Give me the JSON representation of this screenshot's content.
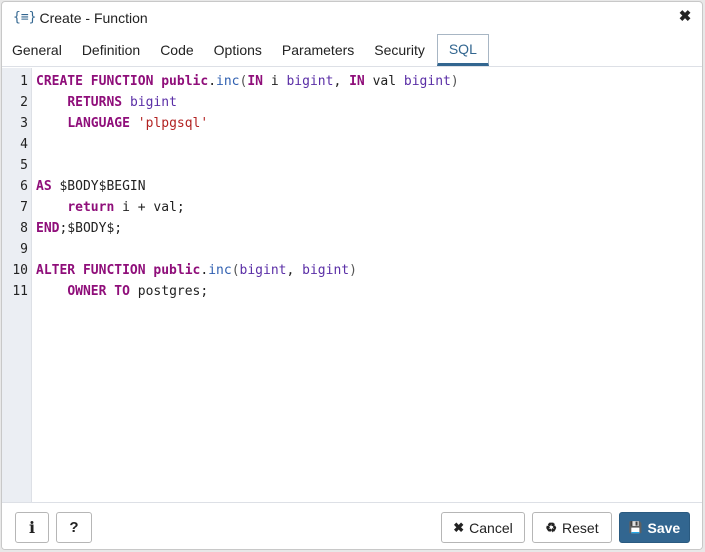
{
  "dialog": {
    "icon": "{≡}",
    "title": "Create - Function",
    "close_glyph": "✖"
  },
  "tabs": [
    {
      "label": "General"
    },
    {
      "label": "Definition"
    },
    {
      "label": "Code"
    },
    {
      "label": "Options"
    },
    {
      "label": "Parameters"
    },
    {
      "label": "Security"
    },
    {
      "label": "SQL",
      "active": true
    }
  ],
  "editor": {
    "line_numbers": [
      "1",
      "2",
      "3",
      "4",
      "5",
      "6",
      "7",
      "8",
      "9",
      "10",
      "11"
    ],
    "lines": [
      [
        {
          "t": "CREATE FUNCTION ",
          "c": "kw"
        },
        {
          "t": "public",
          "c": "kw"
        },
        {
          "t": ".",
          "c": "pl"
        },
        {
          "t": "inc",
          "c": "fn"
        },
        {
          "t": "(",
          "c": "pu"
        },
        {
          "t": "IN",
          "c": "kw"
        },
        {
          "t": " i ",
          "c": "pl"
        },
        {
          "t": "bigint",
          "c": "ty"
        },
        {
          "t": ", ",
          "c": "pl"
        },
        {
          "t": "IN",
          "c": "kw"
        },
        {
          "t": " val ",
          "c": "pl"
        },
        {
          "t": "bigint",
          "c": "ty"
        },
        {
          "t": ")",
          "c": "pu"
        }
      ],
      [
        {
          "t": "    ",
          "c": "pl"
        },
        {
          "t": "RETURNS",
          "c": "kw"
        },
        {
          "t": " ",
          "c": "pl"
        },
        {
          "t": "bigint",
          "c": "ty"
        }
      ],
      [
        {
          "t": "    ",
          "c": "pl"
        },
        {
          "t": "LANGUAGE",
          "c": "kw"
        },
        {
          "t": " ",
          "c": "pl"
        },
        {
          "t": "'plpgsql'",
          "c": "str"
        }
      ],
      [],
      [],
      [
        {
          "t": "AS",
          "c": "kw"
        },
        {
          "t": " $BODY$BEGIN",
          "c": "pl"
        }
      ],
      [
        {
          "t": "    ",
          "c": "pl"
        },
        {
          "t": "return",
          "c": "kw"
        },
        {
          "t": " i + val;",
          "c": "pl"
        }
      ],
      [
        {
          "t": "END",
          "c": "kw"
        },
        {
          "t": ";$BODY$;",
          "c": "pl"
        }
      ],
      [],
      [
        {
          "t": "ALTER FUNCTION ",
          "c": "kw"
        },
        {
          "t": "public",
          "c": "kw"
        },
        {
          "t": ".",
          "c": "pl"
        },
        {
          "t": "inc",
          "c": "fn"
        },
        {
          "t": "(",
          "c": "pu"
        },
        {
          "t": "bigint",
          "c": "ty"
        },
        {
          "t": ", ",
          "c": "pl"
        },
        {
          "t": "bigint",
          "c": "ty"
        },
        {
          "t": ")",
          "c": "pu"
        }
      ],
      [
        {
          "t": "    ",
          "c": "pl"
        },
        {
          "t": "OWNER TO",
          "c": "kw"
        },
        {
          "t": " postgres;",
          "c": "pl"
        }
      ]
    ]
  },
  "footer": {
    "info_glyph": "i",
    "help_glyph": "?",
    "cancel_icon": "✖",
    "cancel_label": "Cancel",
    "reset_icon": "♻",
    "reset_label": "Reset",
    "save_icon": "💾",
    "save_label": "Save"
  },
  "colors": {
    "accent": "#326690",
    "keyword": "#8f0e7a",
    "type": "#5a2ea6",
    "string": "#b22222",
    "function": "#2f5fb0"
  }
}
